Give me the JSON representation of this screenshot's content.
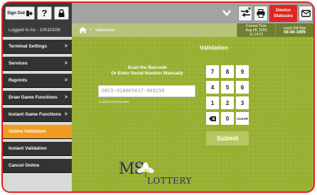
{
  "header": {
    "sign_out_label": "Sign Out",
    "help_label": "?",
    "lock_icon": "lock-icon",
    "sign_out_icon": "exit-arrow-icon",
    "device_status_label_line1": "Device",
    "device_status_label_line2": "Statuses",
    "transfer_icon": "transfer-arrows-icon",
    "printer_icon": "printer-icon",
    "mail_icon": "envelope-icon",
    "status_dot_color": "#1aa23a"
  },
  "subheader": {
    "logged_in": "Logged In As - 10010109",
    "breadcrumb_home_icon": "home-icon",
    "breadcrumb_sep": ">",
    "breadcrumb_current": "Validation",
    "current_time_label": "Current Time",
    "current_time_date": "Aug 08, 2020",
    "current_time_value": "11:14:13",
    "legal_label": "Legal Sell Age",
    "legal_value": "08-08-1999"
  },
  "sidebar": {
    "items": [
      {
        "label": "Terminal Settings",
        "chevron": ">"
      },
      {
        "label": "Services",
        "chevron": ">"
      },
      {
        "label": "Reprints",
        "chevron": ">"
      },
      {
        "label": "Draw Game Functions",
        "chevron": ">"
      },
      {
        "label": "Instant Game Functions",
        "chevron": ">"
      },
      {
        "label": "Online Validation",
        "chevron": ""
      },
      {
        "label": "Instant Validation",
        "chevron": ""
      },
      {
        "label": "Cancel Online",
        "chevron": ""
      }
    ],
    "active_index": 5
  },
  "main": {
    "title": "Validation",
    "scan_line1": "Scan the Barcode",
    "scan_line2": "Or Enter Serial Number Manually",
    "serial_value": "0815-018065617-089250",
    "invalid_text": "Invalid Serial Number",
    "keypad": [
      "7",
      "8",
      "9",
      "4",
      "5",
      "6",
      "1",
      "2",
      "3",
      "",
      "0",
      "CLEAR"
    ],
    "backspace_icon": "backspace-icon",
    "submit_label": "Submit"
  },
  "logo": {
    "ms": "MS",
    "lottery": "LOTTERY"
  },
  "colors": {
    "frame_border": "#e0201c",
    "main_bg": "#98b032",
    "active_nav": "#f29a22",
    "device_status": "#e0251f",
    "logo_navy": "#2c2970"
  }
}
